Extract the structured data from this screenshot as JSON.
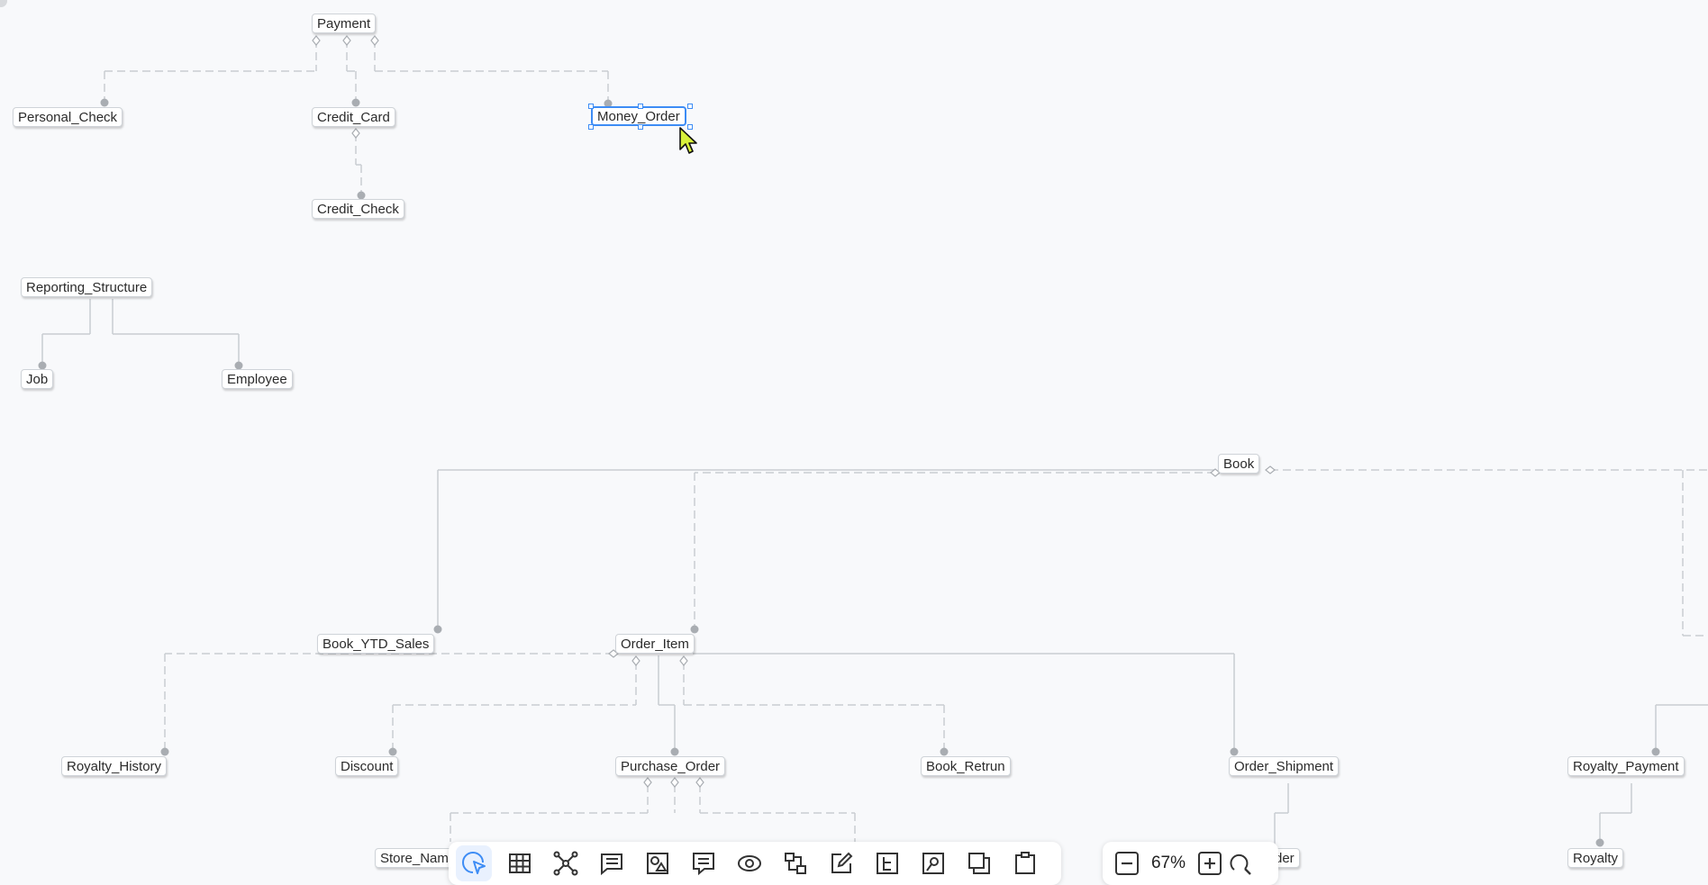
{
  "nodes": {
    "payment": "Payment",
    "personal_check": "Personal_Check",
    "credit_card": "Credit_Card",
    "money_order": "Money_Order",
    "credit_check": "Credit_Check",
    "reporting_structure": "Reporting_Structure",
    "job": "Job",
    "employee": "Employee",
    "book": "Book",
    "book_ytd_sales": "Book_YTD_Sales",
    "order_item": "Order_Item",
    "royalty_history": "Royalty_History",
    "discount": "Discount",
    "purchase_order": "Purchase_Order",
    "book_retrun": "Book_Retrun",
    "order_shipment": "Order_Shipment",
    "royalty_payment": "Royalty_Payment",
    "royalty": "Royalty",
    "store_name_partial": "Store_Nam",
    "order_partial": "rder"
  },
  "selected_node": "Money_Order",
  "toolbar": {
    "tools": [
      "select-tool",
      "table-tool",
      "relationship-tool",
      "view-tool",
      "image-tool",
      "comment-tool",
      "preview-tool",
      "layout-tool",
      "edit-tool",
      "tree-tool",
      "settings-tool",
      "duplicate-tool",
      "clipboard-tool"
    ],
    "active_tool": "select-tool"
  },
  "zoom": {
    "level": "67%"
  },
  "colors": {
    "selection": "#3d8cf5",
    "active_tool_bg": "#e9f1fe",
    "connector": "#c9cdd2",
    "canvas_bg": "#f8f9fb"
  }
}
